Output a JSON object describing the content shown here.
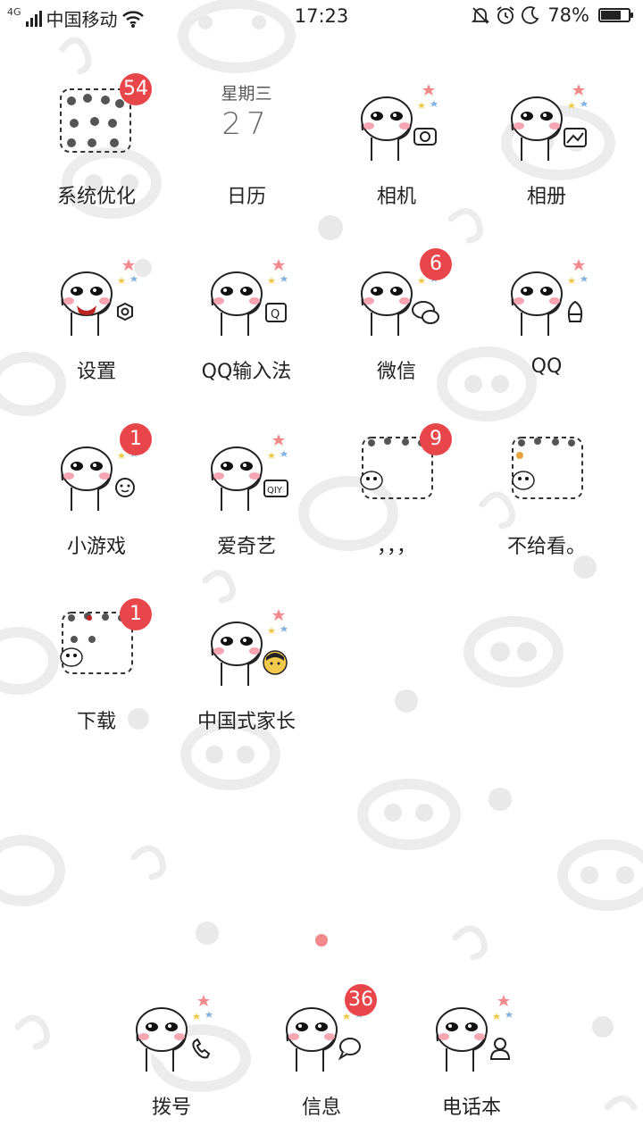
{
  "status_bar": {
    "network": "4G",
    "carrier": "中国移动",
    "time": "17:23",
    "battery_percent": "78%",
    "battery_level": 0.78,
    "icons": [
      "signal-icon",
      "wifi-icon",
      "silent-icon",
      "alarm-icon",
      "moon-icon",
      "battery-icon"
    ]
  },
  "apps": [
    {
      "id": "xitong",
      "label": "系统优化",
      "badge": "54",
      "icon": "folder-stickers-icon"
    },
    {
      "id": "rili",
      "label": "日历",
      "weekday": "星期三",
      "day": "27",
      "icon": "calendar-icon"
    },
    {
      "id": "xiangji",
      "label": "相机",
      "icon": "camera-icon"
    },
    {
      "id": "xiangce",
      "label": "相册",
      "icon": "gallery-icon"
    },
    {
      "id": "shezhi",
      "label": "设置",
      "icon": "settings-icon"
    },
    {
      "id": "qqshurufa",
      "label": "QQ输入法",
      "icon": "qq-input-icon"
    },
    {
      "id": "weixin",
      "label": "微信",
      "badge": "6",
      "icon": "wechat-icon"
    },
    {
      "id": "qq",
      "label": "QQ",
      "icon": "qq-penguin-icon"
    },
    {
      "id": "xiaoyouxi",
      "label": "小游戏",
      "badge": "1",
      "icon": "game-icon"
    },
    {
      "id": "aiqiyi",
      "label": "爱奇艺",
      "icon": "iqiyi-icon"
    },
    {
      "id": "folder1",
      "label": "，，，",
      "badge": "9",
      "icon": "folder-icon"
    },
    {
      "id": "folder2",
      "label": "不给看。",
      "icon": "folder-icon"
    },
    {
      "id": "xiazai",
      "label": "下载",
      "badge": "1",
      "icon": "folder-download-icon"
    },
    {
      "id": "jiazhang",
      "label": "中国式家长",
      "icon": "parents-game-icon"
    }
  ],
  "dock": [
    {
      "id": "bohao",
      "label": "拨号",
      "icon": "phone-icon"
    },
    {
      "id": "xinxi",
      "label": "信息",
      "badge": "36",
      "icon": "message-icon"
    },
    {
      "id": "dianhuaben",
      "label": "电话本",
      "icon": "contacts-icon"
    }
  ],
  "colors": {
    "badge": "#e8464a",
    "page_dot": "#f1898c",
    "blush": "#f6a5b3"
  }
}
